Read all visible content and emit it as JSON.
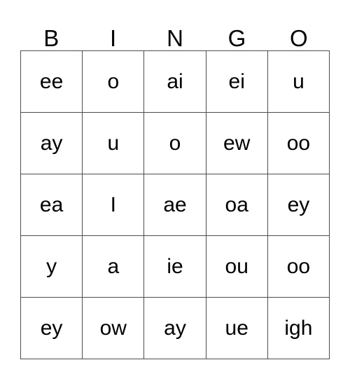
{
  "card": {
    "headers": [
      "B",
      "I",
      "N",
      "G",
      "O"
    ],
    "rows": [
      [
        "ee",
        "o",
        "ai",
        "ei",
        "u"
      ],
      [
        "ay",
        "u",
        "o",
        "ew",
        "oo"
      ],
      [
        "ea",
        "I",
        "ae",
        "oa",
        "ey"
      ],
      [
        "y",
        "a",
        "ie",
        "ou",
        "oo"
      ],
      [
        "ey",
        "ow",
        "ay",
        "ue",
        "igh"
      ]
    ],
    "colors": {
      "grid_line": "#4d4d4d",
      "text": "#000000",
      "background": "#ffffff"
    }
  }
}
